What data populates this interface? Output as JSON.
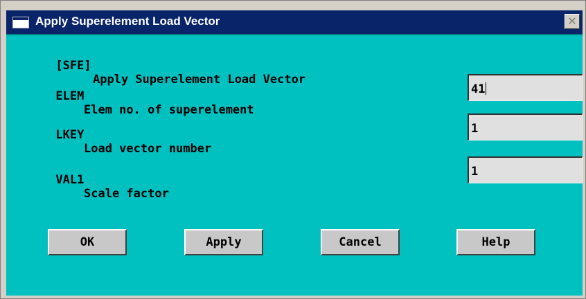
{
  "window": {
    "title": "Apply Superelement Load Vector",
    "close_glyph": "✕"
  },
  "dialog": {
    "header_tag": "[SFE]",
    "header_text": "Apply Superelement Load Vector",
    "rows": [
      {
        "key": "ELEM",
        "label": "Elem no. of superelement",
        "value": "41"
      },
      {
        "key": "LKEY",
        "label": "Load vector number",
        "value": "1"
      },
      {
        "key": "VAL1",
        "label": "Scale factor",
        "value": "1"
      }
    ]
  },
  "buttons": {
    "ok": "OK",
    "apply": "Apply",
    "cancel": "Cancel",
    "help": "Help"
  },
  "colors": {
    "titlebar": "#0a246a",
    "dialog_bg": "#00c0c0",
    "field_bg": "#e0e0e0",
    "button_bg": "#c8c8c8"
  }
}
